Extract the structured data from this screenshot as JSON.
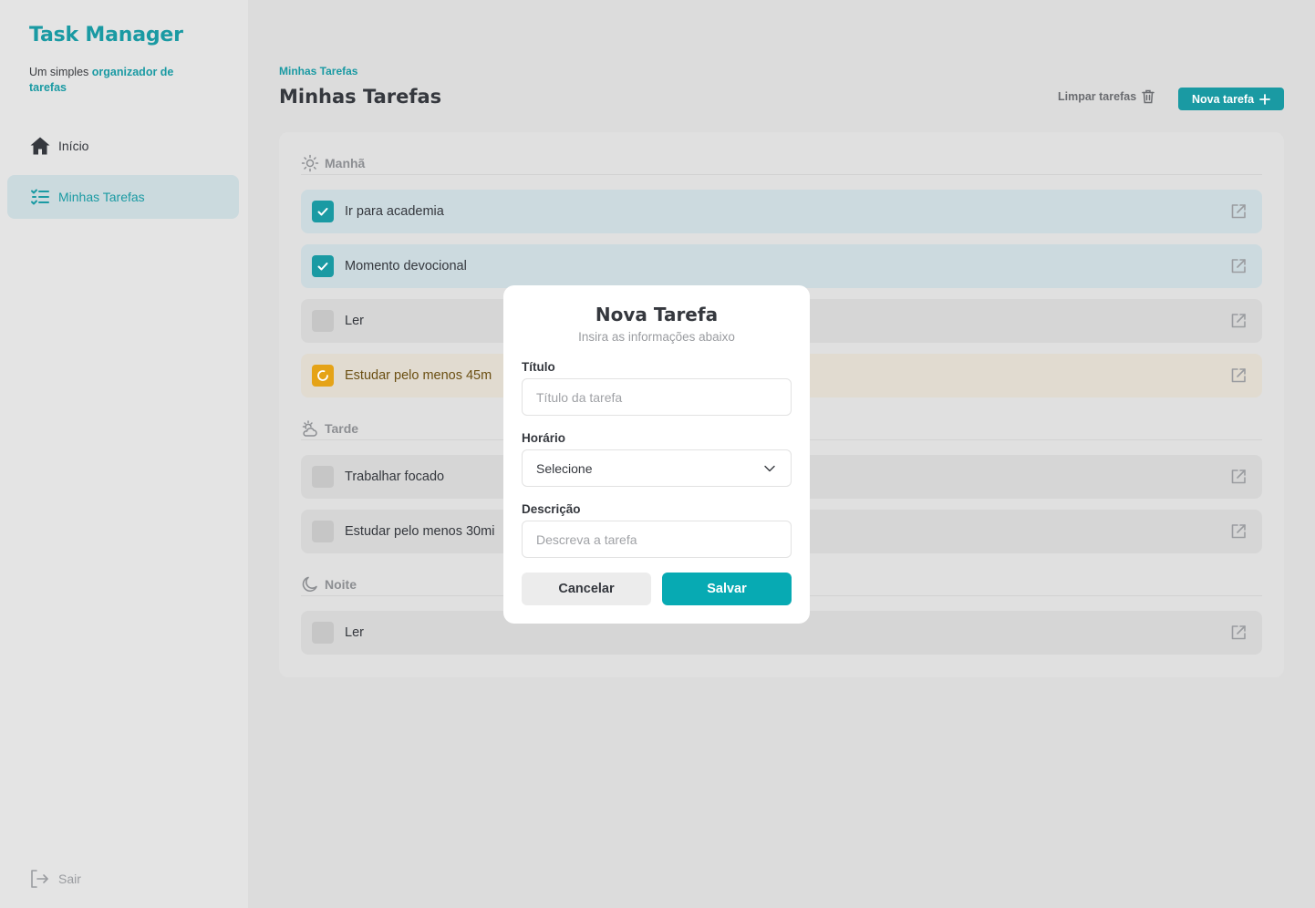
{
  "sidebar": {
    "brand": "Task Manager",
    "tagline_prefix": "Um simples",
    "tagline_highlight": "organizador de tarefas",
    "nav": [
      {
        "label": "Início",
        "icon": "home-icon"
      },
      {
        "label": "Minhas Tarefas",
        "icon": "checklist-icon",
        "active": true
      }
    ],
    "logout_label": "Sair"
  },
  "header": {
    "breadcrumb": "Minhas Tarefas",
    "title": "Minhas Tarefas",
    "clear_label": "Limpar tarefas",
    "new_label": "Nova tarefa"
  },
  "sections": {
    "morning": {
      "title": "Manhã",
      "icon": "sun-icon",
      "tasks": [
        {
          "label": "Ir para academia",
          "status": "done"
        },
        {
          "label": "Momento devocional",
          "status": "done"
        },
        {
          "label": "Ler",
          "status": "todo"
        },
        {
          "label": "Estudar pelo menos 45m",
          "status": "in-progress"
        }
      ]
    },
    "afternoon": {
      "title": "Tarde",
      "icon": "cloud-sun-icon",
      "tasks": [
        {
          "label": "Trabalhar focado",
          "status": "todo"
        },
        {
          "label": "Estudar pelo menos 30mi",
          "status": "todo"
        }
      ]
    },
    "night": {
      "title": "Noite",
      "icon": "moon-icon",
      "tasks": [
        {
          "label": "Ler",
          "status": "todo"
        }
      ]
    }
  },
  "modal": {
    "title": "Nova Tarefa",
    "subtitle": "Insira as informações abaixo",
    "title_label": "Título",
    "title_placeholder": "Título da tarefa",
    "time_label": "Horário",
    "time_value": "Selecione",
    "desc_label": "Descrição",
    "desc_placeholder": "Descreva a tarefa",
    "cancel_label": "Cancelar",
    "save_label": "Salvar"
  },
  "colors": {
    "accent": "#1a9aa3",
    "save": "#07aab3",
    "in_progress": "#e5a317"
  }
}
